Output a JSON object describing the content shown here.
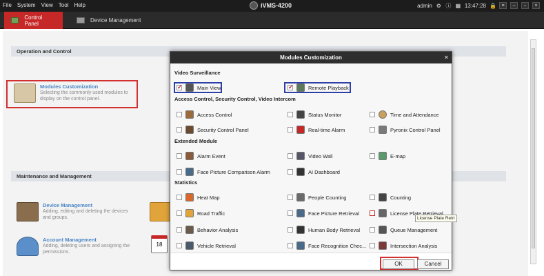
{
  "menu": [
    "File",
    "System",
    "View",
    "Tool",
    "Help"
  ],
  "app_title": "iVMS-4200",
  "status": {
    "user": "admin",
    "time": "13:47:28"
  },
  "tabs": [
    "Control Panel",
    "Device Management"
  ],
  "sections": {
    "operation": "Operation and Control",
    "maintenance": "Maintenance and Management"
  },
  "cards": {
    "modules": {
      "title": "Modules Customization",
      "desc": "Selecting the commonly used modules to display on the control panel."
    },
    "device": {
      "title": "Device Management",
      "desc": "Adding, editing and deleting the devices and groups."
    },
    "account": {
      "title": "Account Management",
      "desc": "Adding, deleting users and assigning the permissions."
    },
    "calendar_num": "18"
  },
  "dialog": {
    "title": "Modules Customization",
    "close": "×",
    "groups": {
      "video": "Video Surveillance",
      "access": "Access Control, Security Control, Video Intercom",
      "extended": "Extended Module",
      "statistics": "Statistics"
    },
    "items": {
      "main_view": "Main View",
      "remote_playback": "Remote Playback",
      "access_control": "Access Control",
      "status_monitor": "Status Monitor",
      "time_attendance": "Time and Attendance",
      "security_panel": "Security Control Panel",
      "realtime_alarm": "Real-time Alarm",
      "pyronix": "Pyronix Control Panel",
      "alarm_event": "Alarm Event",
      "video_wall": "Video Wall",
      "emap": "E-map",
      "face_alarm": "Face Picture Comparison Alarm",
      "ai_dashboard": "AI Dashboard",
      "heat_map": "Heat Map",
      "people_counting": "People Counting",
      "counting": "Counting",
      "road_traffic": "Road Traffic",
      "face_retrieval": "Face Picture Retrieval",
      "plate_retrieval": "License Plate Retrieval",
      "behavior": "Behavior Analysis",
      "human_body": "Human Body Retrieval",
      "queue": "Queue Management",
      "vehicle": "Vehicle Retrieval",
      "face_recognition": "Face Recognition Chec...",
      "intersection": "Intersection Analysis"
    },
    "tooltip": "License Plate Retri",
    "ok": "OK",
    "cancel": "Cancel"
  }
}
